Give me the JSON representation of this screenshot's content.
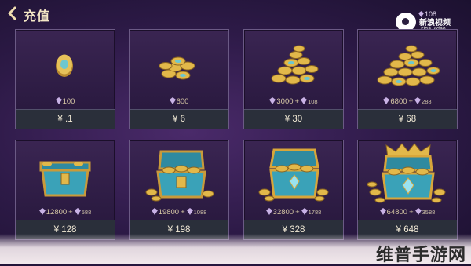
{
  "header": {
    "title": "充值",
    "back_icon": "chevron-left-icon",
    "balance": "108"
  },
  "watermark": {
    "brand": "新浪视频",
    "sub": "sina video",
    "site": "维普手游网"
  },
  "products": [
    {
      "base": "100",
      "bonus": "",
      "price": "¥ .1",
      "art": "single-coin"
    },
    {
      "base": "600",
      "bonus": "",
      "price": "¥  6",
      "art": "small-coin-pile"
    },
    {
      "base": "3000",
      "bonus": "108",
      "price": "¥ 30",
      "art": "coin-pile"
    },
    {
      "base": "6800",
      "bonus": "288",
      "price": "¥ 68",
      "art": "large-coin-pile"
    },
    {
      "base": "12800",
      "bonus": "588",
      "price": "¥ 128",
      "art": "small-chest"
    },
    {
      "base": "19800",
      "bonus": "1088",
      "price": "¥ 198",
      "art": "open-chest"
    },
    {
      "base": "32800",
      "bonus": "1788",
      "price": "¥ 328",
      "art": "jeweled-chest"
    },
    {
      "base": "64800",
      "bonus": "3588",
      "price": "¥ 648",
      "art": "grand-chest"
    }
  ],
  "colors": {
    "gold": "#e2b84a",
    "gem": "#c9b2e6",
    "teal": "#3fb3c7"
  }
}
